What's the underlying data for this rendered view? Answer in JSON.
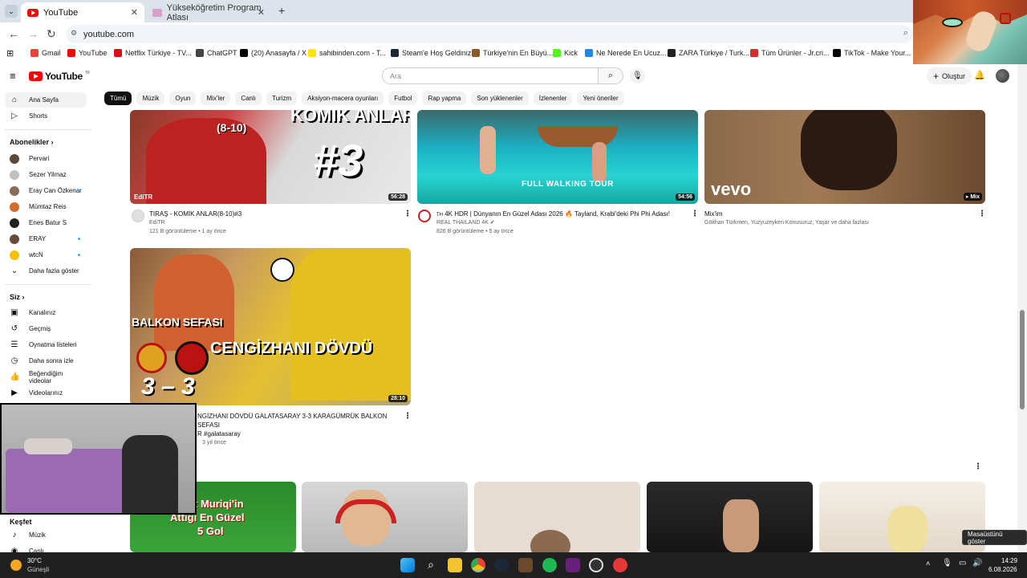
{
  "browser": {
    "tabs": [
      {
        "title": "YouTube",
        "active": true
      },
      {
        "title": "Yükseköğretim Program Atlası",
        "active": false
      }
    ],
    "new_tab_symbol": "+",
    "url": "youtube.com",
    "bookmarks": [
      {
        "label": "Gmail",
        "color": "#ea4335"
      },
      {
        "label": "YouTube",
        "color": "#ff0000"
      },
      {
        "label": "Netflix Türkiye - TV...",
        "color": "#e50914"
      },
      {
        "label": "ChatGPT",
        "color": "#444444"
      },
      {
        "label": "(20) Anasayfa / X",
        "color": "#000000"
      },
      {
        "label": "sahibinden.com - T...",
        "color": "#ffe800"
      },
      {
        "label": "Steam'e Hoş Geldiniz",
        "color": "#1b2838"
      },
      {
        "label": "Türkiye'nin En Büyü...",
        "color": "#8a5a2b"
      },
      {
        "label": "Kick",
        "color": "#53fc18"
      },
      {
        "label": "Ne Nerede En Ucuz...",
        "color": "#1e88e5"
      },
      {
        "label": "ZARA Türkiye / Turk...",
        "color": "#222222"
      },
      {
        "label": "Tüm Ürünler - Jr.cri...",
        "color": "#d32f2f"
      },
      {
        "label": "TikTok - Make Your...",
        "color": "#000000"
      }
    ]
  },
  "youtube": {
    "logo_text": "YouTube",
    "logo_country": "TR",
    "search_placeholder": "Ara",
    "create_label": "Oluştur",
    "chips": [
      "Tümü",
      "Müzik",
      "Oyun",
      "Mix'ler",
      "Canlı",
      "Turizm",
      "Aksiyon-macera oyunları",
      "Futbol",
      "Rap yapma",
      "Son yüklenenler",
      "İzlenenler",
      "Yeni öneriler"
    ],
    "sidebar": {
      "main": [
        {
          "label": "Ana Sayfa",
          "icon": "home-icon"
        },
        {
          "label": "Shorts",
          "icon": "shorts-icon"
        }
      ],
      "subscriptions_title": "Abonelikler",
      "subscriptions": [
        {
          "label": "Pervari",
          "color": "#5a4a3a",
          "dot": false
        },
        {
          "label": "Sezer Yilmaz",
          "color": "#c0c0c0",
          "dot": false
        },
        {
          "label": "Eray Can Özkenar",
          "color": "#8a6b55",
          "dot": true
        },
        {
          "label": "Mümtaz Reis",
          "color": "#d66a2a",
          "dot": false
        },
        {
          "label": "Enes Batur S",
          "color": "#222222",
          "dot": false
        },
        {
          "label": "ERAY",
          "color": "#6a4a3a",
          "dot": true
        },
        {
          "label": "wtcN",
          "color": "#f2c200",
          "dot": true
        }
      ],
      "show_more": "Daha fazla göster",
      "you_title": "Siz",
      "you_items": [
        {
          "label": "Kanalınız",
          "icon": "channel-icon"
        },
        {
          "label": "Geçmiş",
          "icon": "history-icon"
        },
        {
          "label": "Oynatma listeleri",
          "icon": "playlist-icon"
        },
        {
          "label": "Daha sonra izle",
          "icon": "watch-later-icon"
        },
        {
          "label": "Beğendiğim videolar",
          "icon": "like-icon"
        },
        {
          "label": "Videolarınız",
          "icon": "your-videos-icon"
        }
      ],
      "explore_title": "Keşfet",
      "explore_items": [
        {
          "label": "Müzik",
          "icon": "music-icon"
        },
        {
          "label": "Canlı",
          "icon": "live-icon"
        }
      ]
    },
    "videos_row1": [
      {
        "title": "TIRAŞ -  KOMİK ANLAR(8-10)#3",
        "channel": "EdiTR",
        "views": "121 B görüntüleme",
        "age": "1 ay önce",
        "duration": "56:28",
        "thumb_text": "#3",
        "thumb_top_text": "KOMİK ANLAR",
        "thumb_sub": "(8-10)",
        "thumb_badge": "EdiTR"
      },
      {
        "title": "4K HDR | Dünyanın En Güzel Adası 2026 🔥 Tayland, Krabi'deki Phi Phi Adası!",
        "channel": "REAL THAILAND 4K",
        "views": "826 B görüntüleme",
        "age": "5 ay önce",
        "duration": "54:56",
        "thumb_text": "FULL WALKING TOUR",
        "title_prefix": "TH"
      },
      {
        "title": "Mix'im",
        "channel": "Gökhan Türkmen, Yuzyuzeyken Konusuruz, Yaşar ve daha fazlası",
        "duration": "Mix",
        "thumb_text": "vevo"
      }
    ],
    "video_row2": {
      "title_line1": "NGİZHANI DÖVDÜ GALATASARAY 3-3 KARAGÜMRÜK BALKON SEFASI",
      "title_line2": "R #galatasaray",
      "age": "3 yıl önce",
      "duration": "28:10",
      "thumb_line1": "BALKON SEFASI",
      "thumb_line2": "CENGİZHANI DÖVDÜ",
      "thumb_score": "3 – 3"
    },
    "shorts_row": [
      {
        "thumb_line1": "t Muriqi'in",
        "thumb_line2": "Attığı En Güzel",
        "thumb_line3": "5 Gol"
      },
      {},
      {},
      {},
      {}
    ]
  },
  "taskbar": {
    "weather_temp": "30°C",
    "weather_desc": "Güneşli",
    "time": "14:29",
    "date": "6.08.2026",
    "tooltip": "Masaüstünü göster"
  }
}
